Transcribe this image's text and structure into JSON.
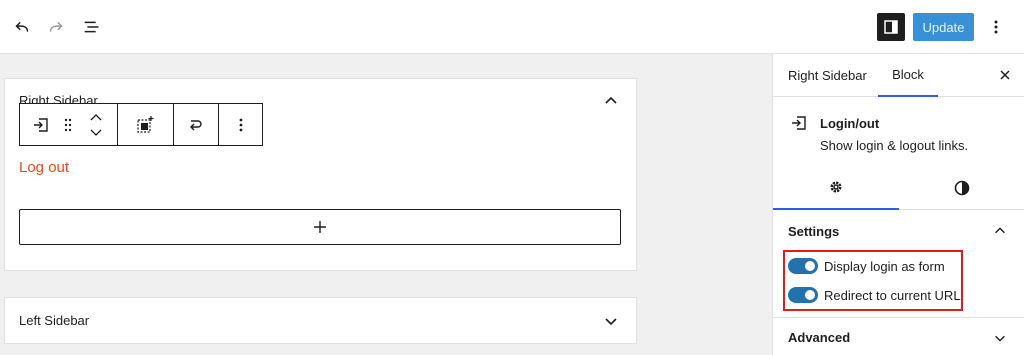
{
  "toolbar": {
    "undo_icon": "undo-icon",
    "redo_icon": "redo-icon",
    "list_view_icon": "list-view-icon",
    "sidebar_toggle_icon": "sidebar-toggle-icon",
    "update_label": "Update",
    "options_icon": "vertical-ellipsis-icon"
  },
  "canvas": {
    "right_sidebar_panel": {
      "title": "Right Sidebar",
      "expanded": true,
      "block_toolbar": [
        "login-out-block-icon",
        "drag-handle-icon",
        "move-up-down-icon",
        "select-parent-icon",
        "redirect-icon",
        "more-options-icon"
      ],
      "logout_text": "Log out",
      "appender_icon": "plus-icon"
    },
    "left_sidebar_panel": {
      "title": "Left Sidebar",
      "expanded": false
    }
  },
  "sidebar": {
    "tabs": [
      {
        "label": "Right Sidebar",
        "active": false
      },
      {
        "label": "Block",
        "active": true
      }
    ],
    "block": {
      "title": "Login/out",
      "description": "Show login & logout links."
    },
    "style_tabs": [
      {
        "icon": "gear-icon",
        "active": true
      },
      {
        "icon": "contrast-icon",
        "active": false
      }
    ],
    "settings": {
      "title": "Settings",
      "toggles": [
        {
          "label": "Display login as form",
          "checked": true
        },
        {
          "label": "Redirect to current URL",
          "checked": true
        }
      ]
    },
    "advanced_title": "Advanced"
  },
  "colors": {
    "accent": "#3858e9",
    "toggle_on": "#2271b1",
    "update_button": "#3890d6",
    "logout_link": "#e24e1b",
    "highlight_border": "#e01c1c"
  }
}
